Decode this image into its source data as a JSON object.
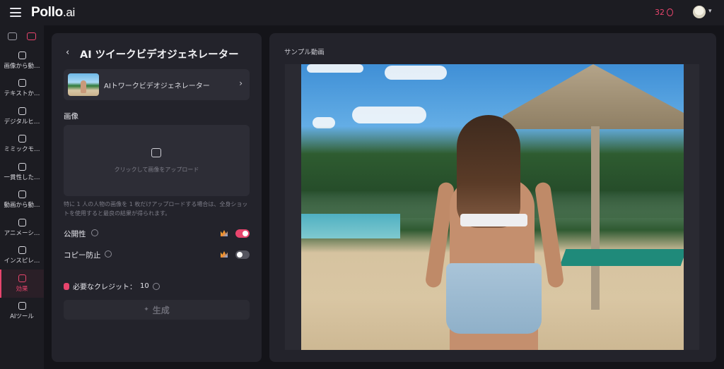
{
  "header": {
    "logo_text": "Pollo",
    "logo_suffix": ".ai",
    "credits": "32",
    "icons": {
      "menu": "hamburger-icon",
      "coin": "coin-icon",
      "avatar": "avatar",
      "dropdown": "chevron-down-icon"
    }
  },
  "sidebar": {
    "top_icons": [
      {
        "name": "image-mode-icon",
        "active": false
      },
      {
        "name": "video-mode-icon",
        "active": true
      }
    ],
    "items": [
      {
        "label": "画像から動…",
        "icon": "image-to-video-icon",
        "active": false
      },
      {
        "label": "テキストか…",
        "icon": "text-to-video-icon",
        "active": false
      },
      {
        "label": "デジタルヒ…",
        "icon": "digital-human-icon",
        "active": false
      },
      {
        "label": "ミミックモ…",
        "icon": "mimic-motion-icon",
        "active": false
      },
      {
        "label": "一貫性した…",
        "icon": "consistent-video-icon",
        "active": false
      },
      {
        "label": "動画から動…",
        "icon": "video-to-video-icon",
        "active": false
      },
      {
        "label": "アニメーシ…",
        "icon": "animation-icon",
        "active": false
      },
      {
        "label": "インスピレ…",
        "icon": "inspiration-icon",
        "active": false
      },
      {
        "label": "効果",
        "icon": "effects-icon",
        "active": true
      },
      {
        "label": "AIツール",
        "icon": "ai-tools-icon",
        "active": false
      }
    ],
    "accent_color": "#e8456d"
  },
  "left_panel": {
    "title": "AI ツイークビデオジェネレーター",
    "model_card": {
      "name": "AIトワークビデオジェネレーター"
    },
    "image_label": "画像",
    "upload_text": "クリックして画像をアップロード",
    "hint": "特に 1 人の人物の画像を 1 枚だけアップロードする場合は、全身ショットを使用すると最良の結果が得られます。",
    "public_label": "公開性",
    "public_on": true,
    "copy_protect_label": "コピー防止",
    "copy_protect_on": false,
    "credits_label": "必要なクレジット：",
    "credits_value": "10",
    "generate_label": "生成"
  },
  "right_panel": {
    "sample_label": "サンプル動画"
  }
}
